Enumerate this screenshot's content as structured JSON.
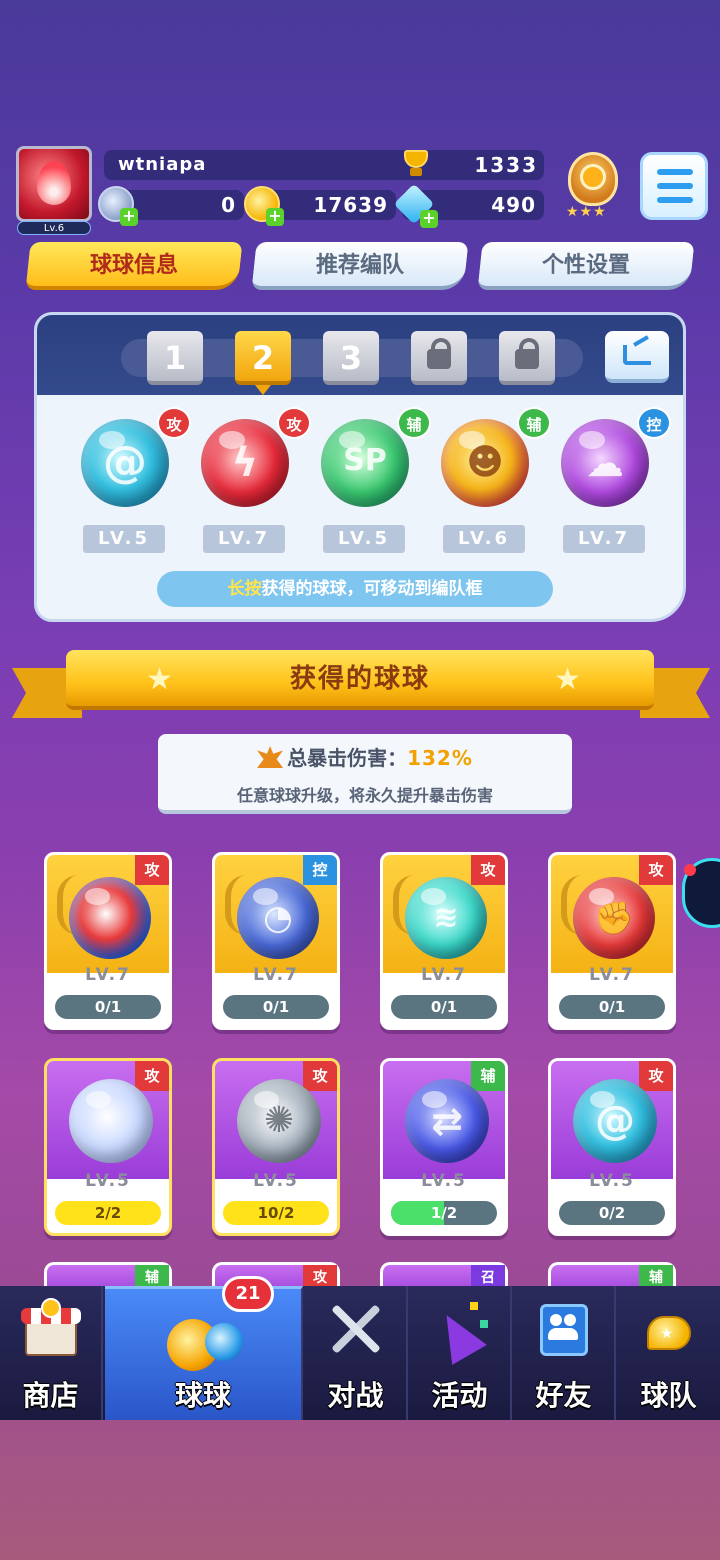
{
  "player": {
    "name": "wtniapa",
    "level": "Lv.6",
    "trophies": "1333",
    "silver": "0",
    "gold": "17639",
    "gems": "490"
  },
  "tabs": [
    {
      "label": "球球信息"
    },
    {
      "label": "推荐编队"
    },
    {
      "label": "个性设置"
    }
  ],
  "team": {
    "slots": [
      "1",
      "2",
      "3"
    ],
    "active_slot": "2",
    "members": [
      {
        "type": "攻",
        "level": "LV.5"
      },
      {
        "type": "攻",
        "level": "LV.7"
      },
      {
        "type": "辅",
        "level": "LV.5",
        "symbol": "SP"
      },
      {
        "type": "辅",
        "level": "LV.6"
      },
      {
        "type": "控",
        "level": "LV.7"
      }
    ],
    "hint_highlight": "长按",
    "hint_text": "获得的球球，可移动到编队框"
  },
  "section_title": "获得的球球",
  "crit": {
    "label": "总暴击伤害：",
    "value": "132%",
    "desc": "任意球球升级，将永久提升暴击伤害"
  },
  "cards": [
    {
      "type": "攻",
      "level": "LV.7",
      "progress": "0/1",
      "fill": 0
    },
    {
      "type": "控",
      "level": "LV.7",
      "progress": "0/1",
      "fill": 0
    },
    {
      "type": "攻",
      "level": "LV.7",
      "progress": "0/1",
      "fill": 0
    },
    {
      "type": "攻",
      "level": "LV.7",
      "progress": "0/1",
      "fill": 0
    },
    {
      "type": "攻",
      "level": "LV.5",
      "progress": "2/2",
      "fill": 1
    },
    {
      "type": "攻",
      "level": "LV.5",
      "progress": "10/2",
      "fill": 1
    },
    {
      "type": "辅",
      "level": "LV.5",
      "progress": "1/2",
      "fill": 0.5
    },
    {
      "type": "攻",
      "level": "LV.5",
      "progress": "0/2",
      "fill": 0
    }
  ],
  "partial_cards": [
    "辅",
    "攻",
    "召",
    "辅"
  ],
  "nav": {
    "items": [
      "商店",
      "球球",
      "对战",
      "活动",
      "好友",
      "球队"
    ],
    "active": "球球",
    "badge": "21"
  },
  "colors": {
    "attack": "#e23a3a",
    "support": "#3db84a",
    "control": "#2a92e0",
    "gold_accent": "#ffc21a"
  }
}
